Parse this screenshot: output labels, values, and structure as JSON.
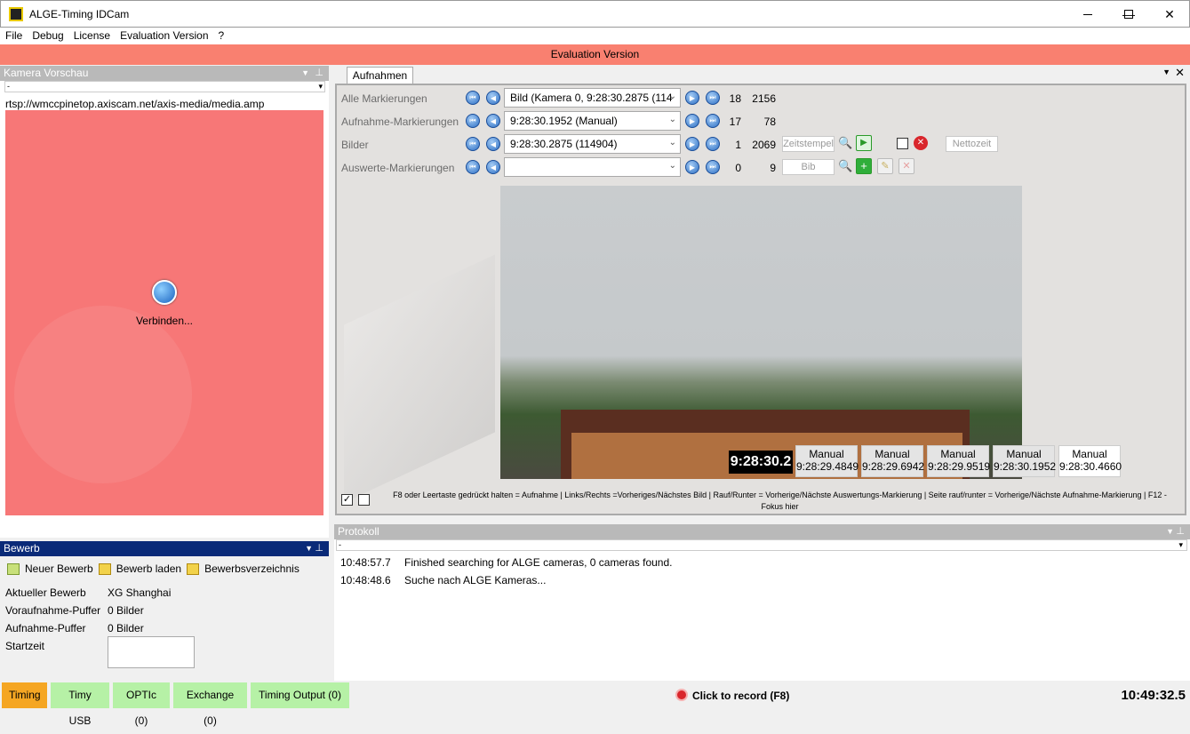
{
  "window": {
    "title": "ALGE-Timing IDCam",
    "minimize": "—",
    "maximize": "☐",
    "close": "✕"
  },
  "menu": [
    "File",
    "Debug",
    "License",
    "Evaluation Version",
    "?"
  ],
  "eval_banner": "Evaluation Version",
  "kamera": {
    "title": "Kamera Vorschau",
    "dropdown": "-",
    "url": "rtsp://wmccpinetop.axiscam.net/axis-media/media.amp",
    "connecting": "Verbinden..."
  },
  "bewerb": {
    "title": "Bewerb",
    "toolbar": [
      "Neuer Bewerb",
      "Bewerb laden",
      "Bewerbsverzeichnis"
    ],
    "fields": [
      {
        "label": "Aktueller Bewerb",
        "value": "XG Shanghai"
      },
      {
        "label": "Voraufnahme-Puffer",
        "value": "0 Bilder"
      },
      {
        "label": "Aufnahme-Puffer",
        "value": "0 Bilder"
      },
      {
        "label": "Startzeit",
        "value": ""
      }
    ]
  },
  "aufnahmen": {
    "tab": "Aufnahmen",
    "rows": [
      {
        "label": "Alle Markierungen",
        "combo": "Bild (Kamera 0, 9:28:30.2875 (114",
        "n1": "18",
        "n2": "2156"
      },
      {
        "label": "Aufnahme-Markierungen",
        "combo": "9:28:30.1952 (Manual)",
        "n1": "17",
        "n2": "78"
      },
      {
        "label": "Bilder",
        "combo": "9:28:30.2875 (114904)",
        "n1": "1",
        "n2": "2069"
      },
      {
        "label": "Auswerte-Markierungen",
        "combo": "",
        "n1": "0",
        "n2": "9"
      }
    ],
    "zeitstempel_placeholder": "Zeitstempel",
    "bib_placeholder": "Bib",
    "nettozeit": "Nettozeit",
    "current_time": "9:28:30.2",
    "marks": [
      {
        "type": "Manual",
        "time": "9:28:29.4849"
      },
      {
        "type": "Manual",
        "time": "9:28:29.6942"
      },
      {
        "type": "Manual",
        "time": "9:28:29.9519"
      },
      {
        "type": "Manual",
        "time": "9:28:30.1952"
      },
      {
        "type": "Manual",
        "time": "9:28:30.4660"
      }
    ],
    "help": "F8 oder Leertaste gedrückt halten = Aufnahme | Links/Rechts =Vorheriges/Nächstes Bild | Rauf/Runter = Vorherige/Nächste Auswertungs-Markierung | Seite rauf/runter = Vorherige/Nächste Aufnahme-Markierung | F12 - Fokus hier"
  },
  "protokoll": {
    "title": "Protokoll",
    "dropdown": "-",
    "entries": [
      {
        "time": "10:48:57.7",
        "msg": "Finished searching for ALGE cameras, 0 cameras found."
      },
      {
        "time": "10:48:48.6",
        "msg": "Suche nach ALGE Kameras..."
      }
    ]
  },
  "statusbar": {
    "buttons": [
      "Timing",
      "Timy USB",
      "OPTIc (0)",
      "Exchange (0)",
      "Timing Output (0)"
    ],
    "record": "Click to record (F8)",
    "clock": "10:49:32.5"
  },
  "colors": {
    "eval": "#f98070",
    "preview": "#f77777",
    "timing": "#f5a623",
    "green": "#b6f1a6",
    "bewerb_head": "#0a2a78"
  }
}
